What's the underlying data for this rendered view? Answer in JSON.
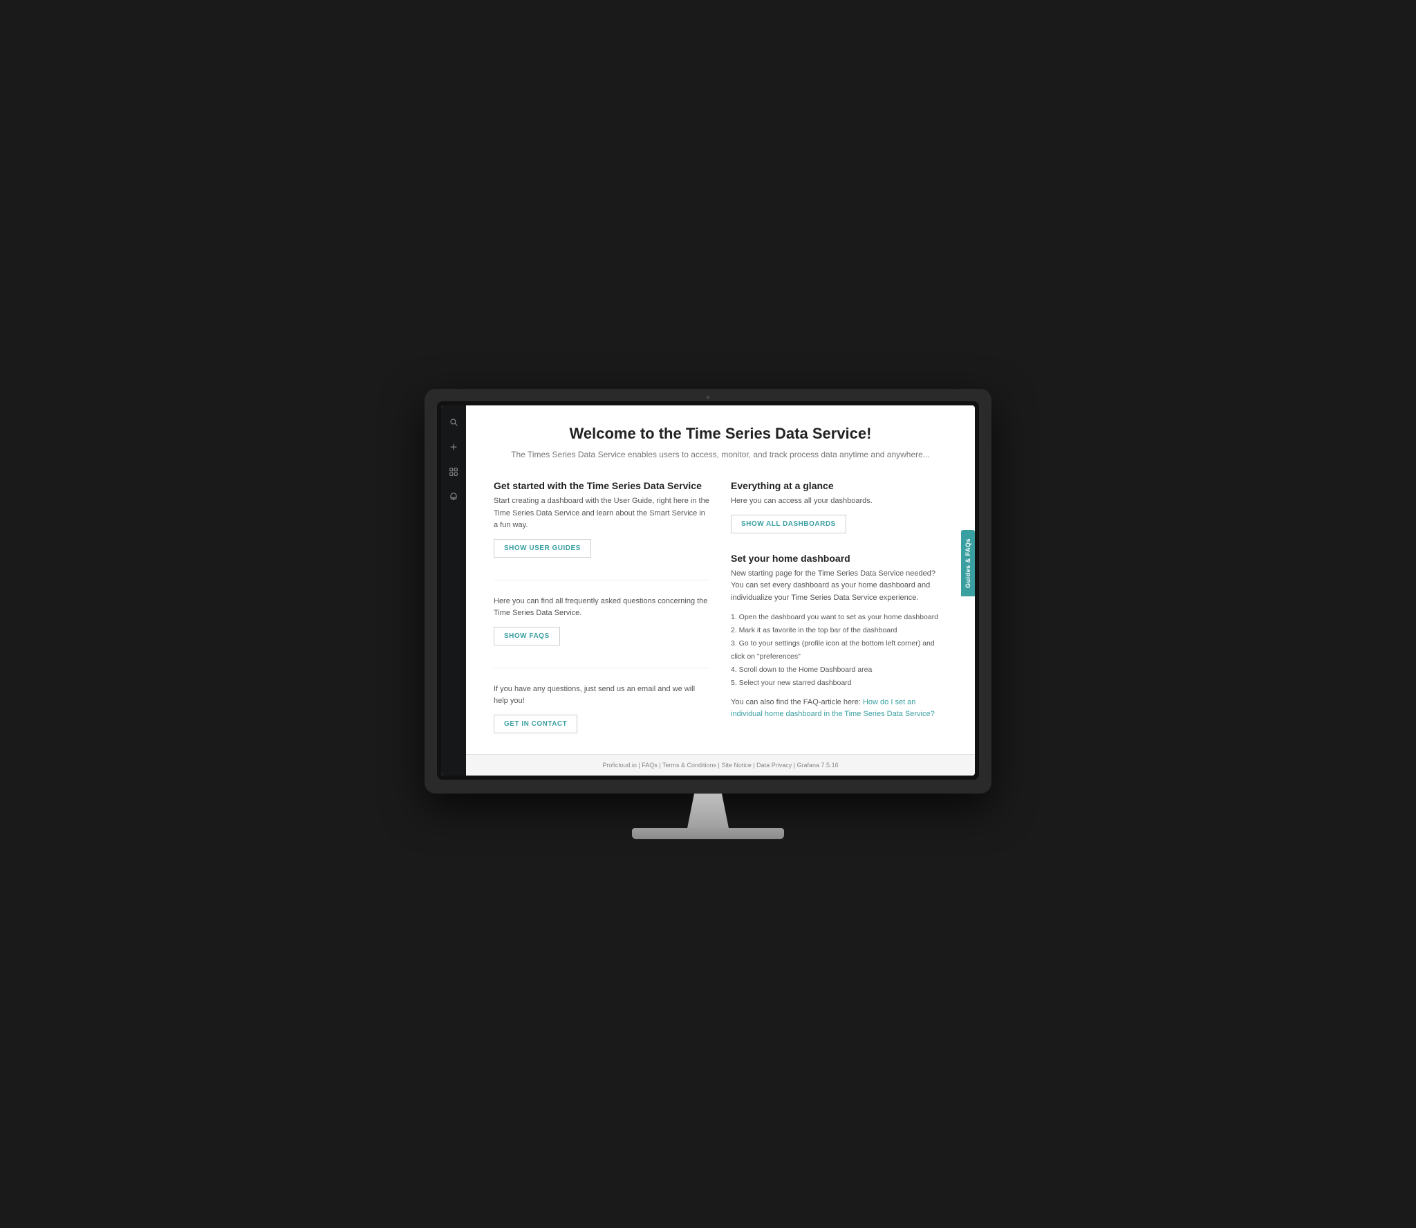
{
  "monitor": {
    "camera_label": "camera"
  },
  "sidebar": {
    "icons": [
      {
        "name": "search-icon",
        "label": "Search"
      },
      {
        "name": "plus-icon",
        "label": "Add"
      },
      {
        "name": "dashboard-icon",
        "label": "Dashboard"
      },
      {
        "name": "bell-icon",
        "label": "Notifications"
      }
    ]
  },
  "page": {
    "title": "Welcome to the Time Series Data Service!",
    "subtitle": "The Times Series Data Service enables users to access, monitor, and track process data anytime and anywhere...",
    "left_column": {
      "section1": {
        "title": "Get started with the Time Series Data Service",
        "text": "Start creating a dashboard with the User Guide, right here in the Time Series Data Service and learn about the Smart Service in a fun way.",
        "button": "SHOW USER GUIDES"
      },
      "section2": {
        "text": "Here you can find all frequently asked questions concerning the Time Series Data Service.",
        "button": "SHOW FAQS"
      },
      "section3": {
        "text": "If you have any questions, just send us an email and we will help you!",
        "button": "GET IN CONTACT"
      }
    },
    "right_column": {
      "section1": {
        "title": "Everything at a glance",
        "text": "Here you can access all your dashboards.",
        "button": "SHOW ALL DASHBOARDS"
      },
      "section2": {
        "title": "Set your home dashboard",
        "intro": "New starting page for the Time Series Data Service needed? You can set every dashboard as your home dashboard and individualize your Time Series Data Service experience.",
        "steps": [
          "1. Open the dashboard you want to set as your home dashboard",
          "2. Mark it as favorite in the top bar of the dashboard",
          "3. Go to your settings (profile icon at the bottom left corner) and click on \"preferences\"",
          "4. Scroll down to the Home Dashboard area",
          "5. Select your new starred dashboard"
        ],
        "faq_prefix": "You can also find the FAQ-article here: ",
        "faq_link_text": "How do I set an individual home dashboard in the Time Series Data Service?",
        "faq_link_url": "#"
      }
    },
    "footer": {
      "links": "Proficloud.io | FAQs | Terms & Conditions | Site Notice | Data Privacy | Grafana 7.5.16"
    }
  },
  "side_tab": {
    "label": "Guides & FAQs"
  }
}
